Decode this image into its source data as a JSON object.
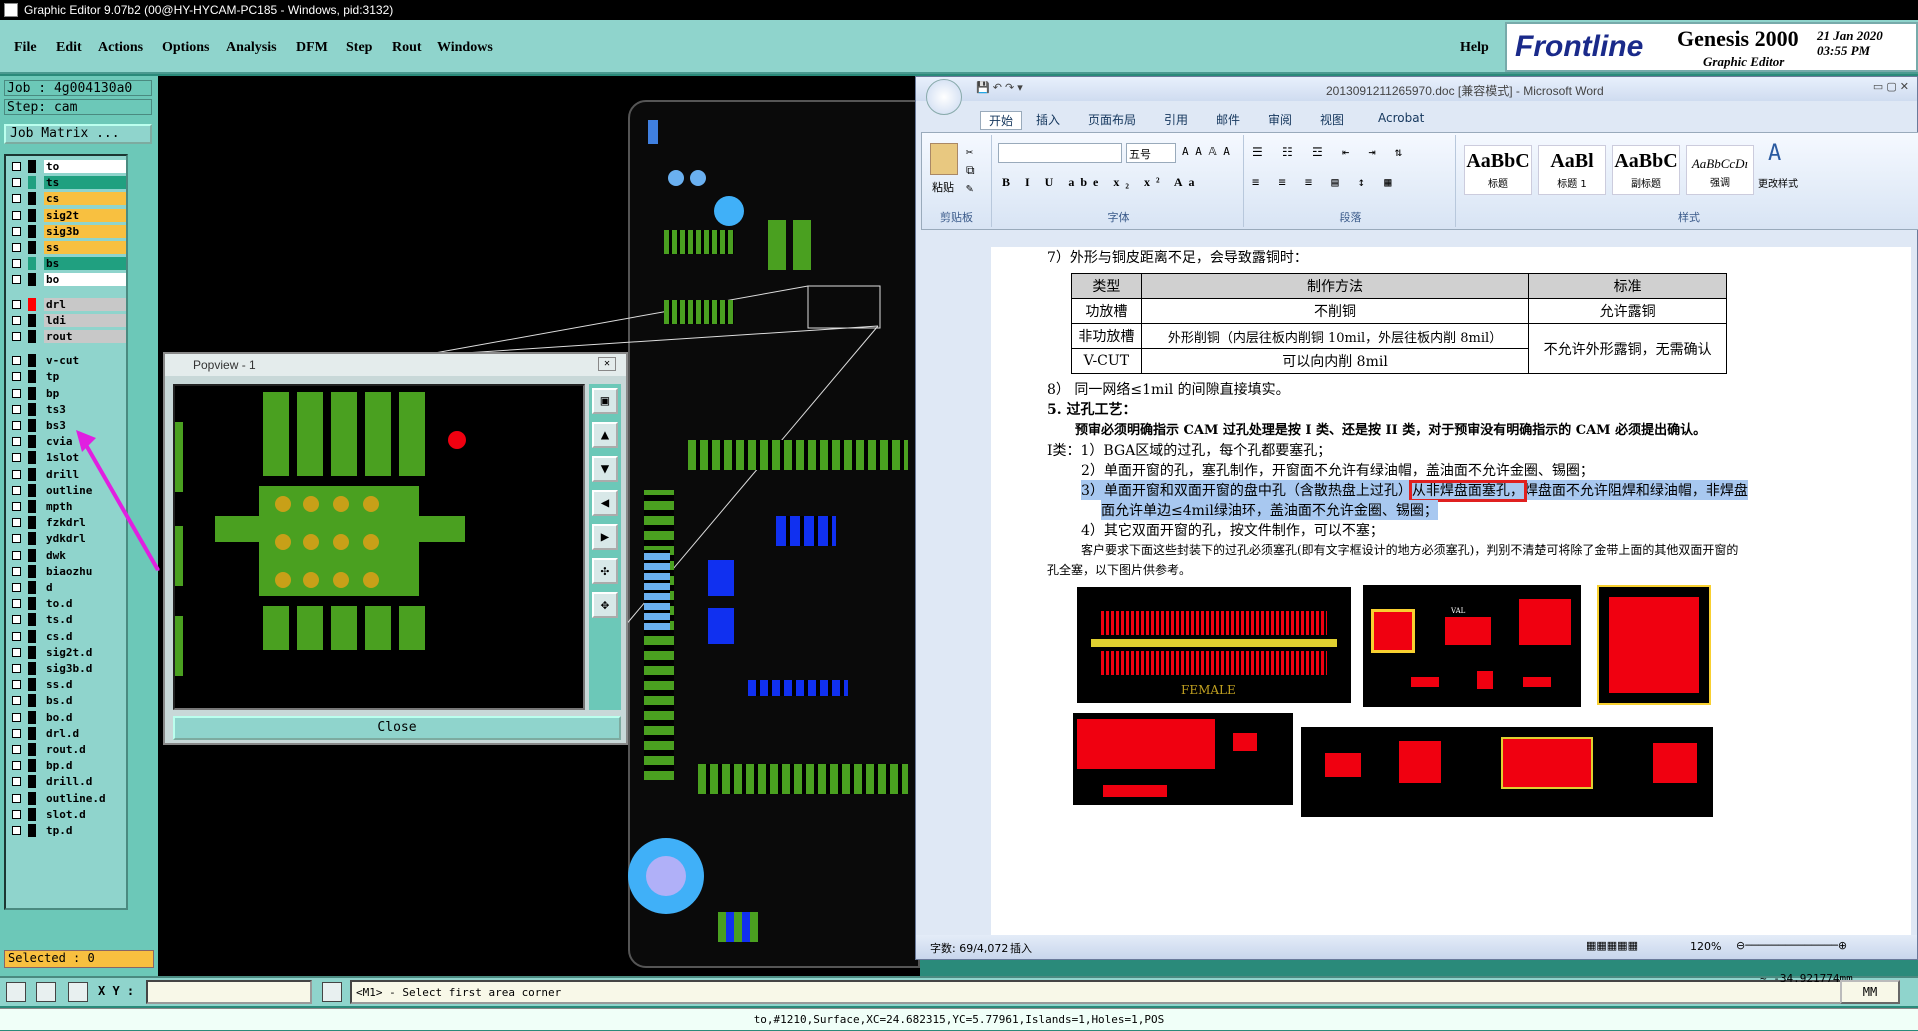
{
  "window": {
    "title": "Graphic Editor 9.07b2 (00@HY-HYCAM-PC185 - Windows, pid:3132)"
  },
  "menu": {
    "items": [
      "File",
      "Edit",
      "Actions",
      "Options",
      "Analysis",
      "DFM",
      "Step",
      "Rout",
      "Windows"
    ],
    "help": "Help"
  },
  "logo": {
    "brand": "Frontline",
    "product": "Genesis 2000",
    "subtitle": "Graphic Editor",
    "date": "21 Jan 2020",
    "time": "03:55 PM"
  },
  "job": {
    "job": "Job : 4g004130a0",
    "step": "Step: cam",
    "matrix_button": "Job Matrix ..."
  },
  "layers": [
    {
      "name": "to",
      "color": "#ffffff",
      "swatch": "#000000"
    },
    {
      "name": "ts",
      "color": "#20a080",
      "swatch": "#20a080"
    },
    {
      "name": "cs",
      "color": "#f8c040",
      "swatch": "#000000"
    },
    {
      "name": "sig2t",
      "color": "#f8c040",
      "swatch": "#000000"
    },
    {
      "name": "sig3b",
      "color": "#f8c040",
      "swatch": "#000000"
    },
    {
      "name": "ss",
      "color": "#f8c040",
      "swatch": "#000000"
    },
    {
      "name": "bs",
      "color": "#20a080",
      "swatch": "#20a080"
    },
    {
      "name": "bo",
      "color": "#ffffff",
      "swatch": "#000000"
    },
    {
      "name": "drl",
      "color": "#c8c8c8",
      "swatch": "#ff0000"
    },
    {
      "name": "ldi",
      "color": "#c8c8c8",
      "swatch": "#000000"
    },
    {
      "name": "rout",
      "color": "#c8c8c8",
      "swatch": "#000000"
    },
    {
      "name": "v-cut",
      "color": "#8fd4cc",
      "swatch": "#000000"
    },
    {
      "name": "tp",
      "color": "#8fd4cc",
      "swatch": "#000000"
    },
    {
      "name": "bp",
      "color": "#8fd4cc",
      "swatch": "#000000"
    },
    {
      "name": "ts3",
      "color": "#8fd4cc",
      "swatch": "#000000"
    },
    {
      "name": "bs3",
      "color": "#8fd4cc",
      "swatch": "#000000"
    },
    {
      "name": "cvia",
      "color": "#8fd4cc",
      "swatch": "#000000"
    },
    {
      "name": "1slot",
      "color": "#8fd4cc",
      "swatch": "#000000"
    },
    {
      "name": "drill",
      "color": "#8fd4cc",
      "swatch": "#000000"
    },
    {
      "name": "outline",
      "color": "#8fd4cc",
      "swatch": "#000000"
    },
    {
      "name": "mpth",
      "color": "#8fd4cc",
      "swatch": "#000000"
    },
    {
      "name": "fzkdrl",
      "color": "#8fd4cc",
      "swatch": "#000000"
    },
    {
      "name": "ydkdrl",
      "color": "#8fd4cc",
      "swatch": "#000000"
    },
    {
      "name": "dwk",
      "color": "#8fd4cc",
      "swatch": "#000000"
    },
    {
      "name": "biaozhu",
      "color": "#8fd4cc",
      "swatch": "#000000"
    },
    {
      "name": "d",
      "color": "#8fd4cc",
      "swatch": "#000000"
    },
    {
      "name": "to.d",
      "color": "#8fd4cc",
      "swatch": "#000000"
    },
    {
      "name": "ts.d",
      "color": "#8fd4cc",
      "swatch": "#000000"
    },
    {
      "name": "cs.d",
      "color": "#8fd4cc",
      "swatch": "#000000"
    },
    {
      "name": "sig2t.d",
      "color": "#8fd4cc",
      "swatch": "#000000"
    },
    {
      "name": "sig3b.d",
      "color": "#8fd4cc",
      "swatch": "#000000"
    },
    {
      "name": "ss.d",
      "color": "#8fd4cc",
      "swatch": "#000000"
    },
    {
      "name": "bs.d",
      "color": "#8fd4cc",
      "swatch": "#000000"
    },
    {
      "name": "bo.d",
      "color": "#8fd4cc",
      "swatch": "#000000"
    },
    {
      "name": "drl.d",
      "color": "#8fd4cc",
      "swatch": "#000000"
    },
    {
      "name": "rout.d",
      "color": "#8fd4cc",
      "swatch": "#000000"
    },
    {
      "name": "bp.d",
      "color": "#8fd4cc",
      "swatch": "#000000"
    },
    {
      "name": "drill.d",
      "color": "#8fd4cc",
      "swatch": "#000000"
    },
    {
      "name": "outline.d",
      "color": "#8fd4cc",
      "swatch": "#000000"
    },
    {
      "name": "slot.d",
      "color": "#8fd4cc",
      "swatch": "#000000"
    },
    {
      "name": "tp.d",
      "color": "#8fd4cc",
      "swatch": "#000000"
    }
  ],
  "selected": "Selected : 0",
  "popview": {
    "title": "Popview - 1",
    "close": "Close"
  },
  "word": {
    "title": "2013091211265970.doc [兼容模式] - Microsoft Word",
    "tabs": [
      "开始",
      "插入",
      "页面布局",
      "引用",
      "邮件",
      "审阅",
      "视图",
      "Acrobat"
    ],
    "groups": {
      "clipboard": "剪贴板",
      "font": "字体",
      "paragraph": "段落",
      "styles": "样式",
      "paste": "粘贴",
      "change_styles": "更改样式"
    },
    "font_size": "五号",
    "styles": [
      {
        "preview": "AaBbC",
        "name": "标题"
      },
      {
        "preview": "AaBl",
        "name": "标题 1"
      },
      {
        "preview": "AaBbC",
        "name": "副标题"
      },
      {
        "preview": "AaBbCcDı",
        "name": "强调"
      }
    ],
    "doc": {
      "l7": "7）外形与铜皮距离不足，会导致露铜时：",
      "table_head": [
        "类型",
        "制作方法",
        "标准"
      ],
      "row1": [
        "功放槽",
        "不削铜",
        "允许露铜"
      ],
      "row2a": "非功放槽",
      "row2b": "外形削铜（内层往板内削铜 10mil，外层往板内削 8mil）",
      "row2c": "不允许外形露铜，无需确认",
      "row3": [
        "V-CUT",
        "可以向内削 8mil"
      ],
      "l8": "8） 同一网络≤1mil 的间隙直接填实。",
      "l5": "5.   过孔工艺：",
      "bold": "预审必须明确指示 CAM 过孔处理是按 I 类、还是按 II 类，对于预审没有明确指示的 CAM 必须提出确认。",
      "i1": "I类：1）BGA区域的过孔，每个孔都要塞孔；",
      "i2": "2）单面开窗的孔，塞孔制作，开窗面不允许有绿油帽，盖油面不允许金圈、锡圈；",
      "i3a": "3）单面开窗和双面开窗的盘中孔（含散热盘上过孔）",
      "i3b": "从非焊盘面塞孔，",
      "i3c": "焊盘面不允许阻焊和绿油帽，非焊盘",
      "i3d": "面允许单边≤4mil绿油环，盖油面不允许金圈、锡圈；",
      "i4": "4）其它双面开窗的孔，按文件制作，可以不塞；",
      "note1": "客户要求下面这些封装下的过孔必须塞孔(即有文字框设计的地方必须塞孔)，判别不清楚可将除了金带上面的其他双面开窗的",
      "note2": "孔全塞，以下图片供参考。",
      "female": "FEMALE",
      "val": "VAL"
    },
    "status": {
      "words": "字数: 69/4,072",
      "insert": "插入",
      "zoom": "120%"
    }
  },
  "cmd": {
    "xy": "X Y :",
    "prompt": "<M1> - Select first area corner",
    "unit": "MM",
    "coords": "~ -34.921774mm"
  },
  "status": "to,#1210,Surface,XC=24.682315,YC=5.77961,Islands=1,Holes=1,POS"
}
